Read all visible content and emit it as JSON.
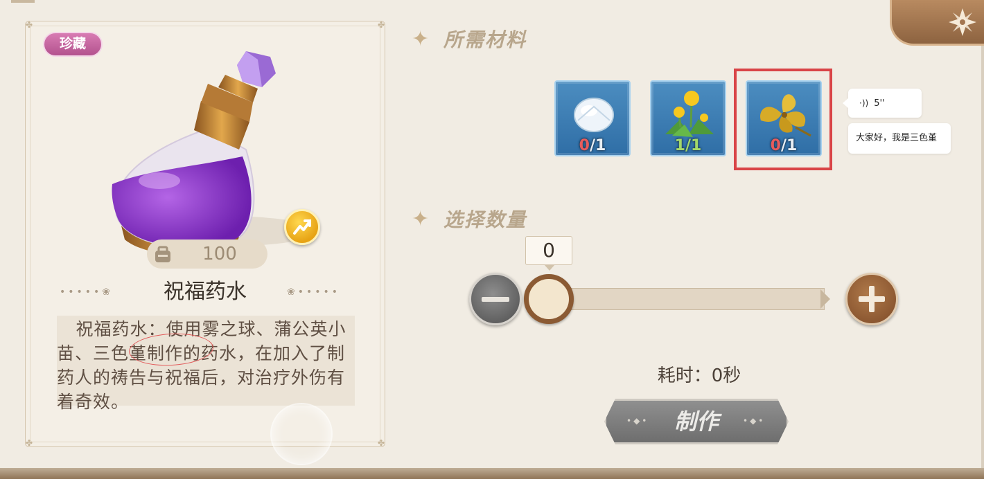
{
  "item": {
    "tag": "珍藏",
    "name": "祝福药水",
    "weight": "100",
    "description": "祝福药水：使用雾之球、蒲公英小苗、三色堇制作的药水，在加入了制药人的祷告与祝福后，对治疗外伤有着奇效。"
  },
  "materials_section": {
    "title": "所需材料",
    "items": [
      {
        "name": "雾之球",
        "have": "0",
        "rest": "/1",
        "icon": "crystal-orb-icon"
      },
      {
        "name": "蒲公英小苗",
        "have": "1",
        "rest": "/1",
        "icon": "dandelion-icon"
      },
      {
        "name": "三色堇",
        "have": "0",
        "rest": "/1",
        "icon": "pansy-icon"
      }
    ]
  },
  "quantity_section": {
    "title": "选择数量",
    "value": "0",
    "slider_fraction": 0
  },
  "time_label": "耗时：0秒",
  "craft_button": "制作",
  "chat": {
    "voice_duration": "5''",
    "message": "大家好，我是三色堇"
  },
  "colors": {
    "panel_bg": "#f1ece3",
    "accent_brown": "#8b5a33",
    "material_bg": "#3a7ab0",
    "missing_red": "#e85c5c",
    "ok_green": "#a4d86a",
    "highlight_red": "#d94447",
    "tag_pink": "#c466a0"
  }
}
